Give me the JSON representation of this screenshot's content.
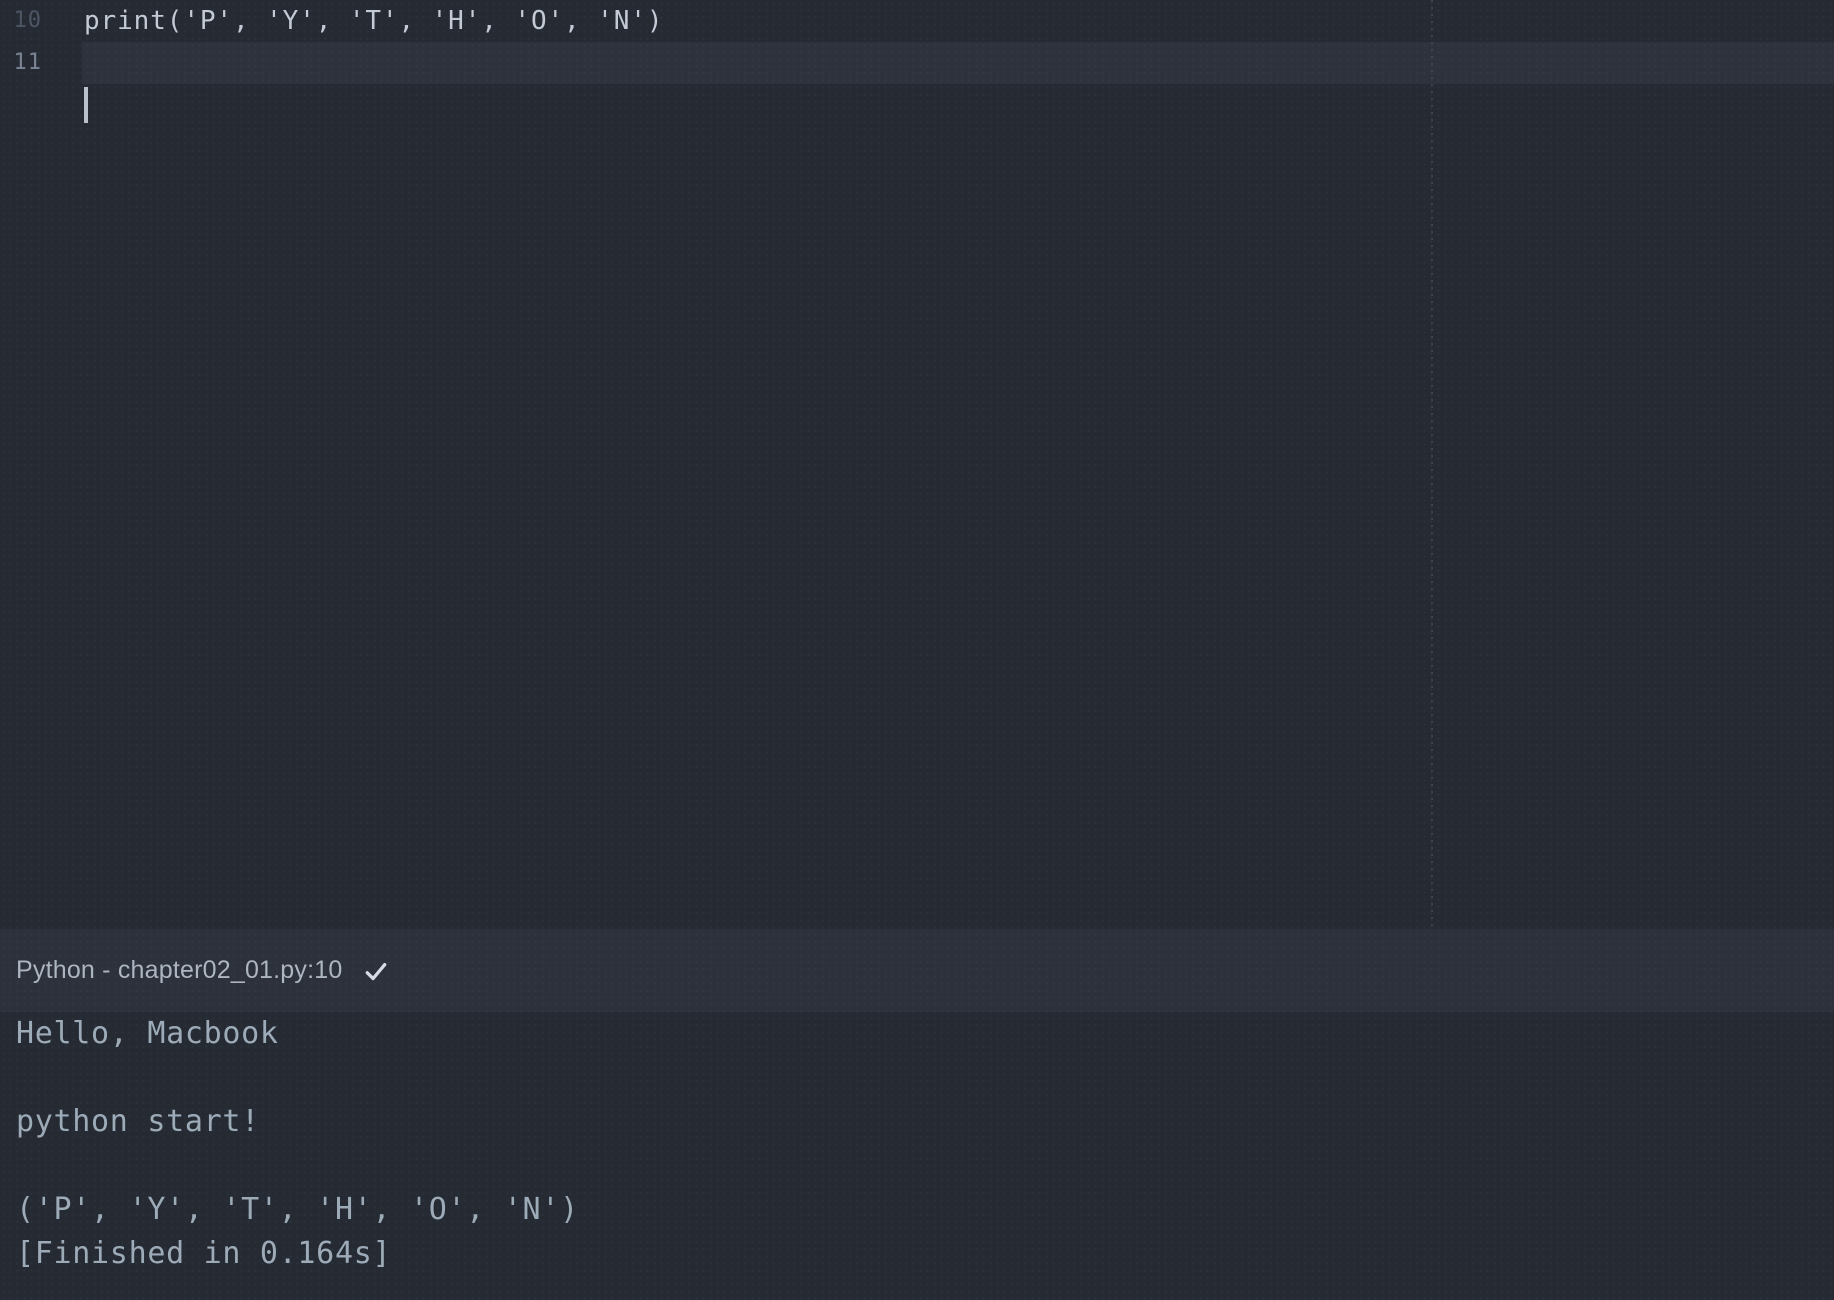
{
  "editor": {
    "lines": [
      {
        "number": "10",
        "code": "print('P', 'Y', 'T', 'H', 'O', 'N')"
      },
      {
        "number": "11",
        "code": ""
      }
    ],
    "active_line": "11"
  },
  "build_panel": {
    "header": "Python - chapter02_01.py:10",
    "status_icon": "check-icon",
    "output_lines": [
      "Hello, Macbook",
      "",
      "python start!",
      "",
      "('P', 'Y', 'T', 'H', 'O', 'N')",
      "[Finished in 0.164s]"
    ]
  },
  "colors": {
    "background": "#252a33",
    "current_line_highlight": "#2d323d",
    "panel_header_bg": "#2c313c",
    "code_text": "#c3cad5",
    "output_text": "#9dabb8",
    "line_number_inactive": "#4d5565",
    "line_number_active": "#7b8494",
    "caret": "#b9c1cc",
    "check_icon": "#d6dce3",
    "ruler": "#4a5160"
  }
}
